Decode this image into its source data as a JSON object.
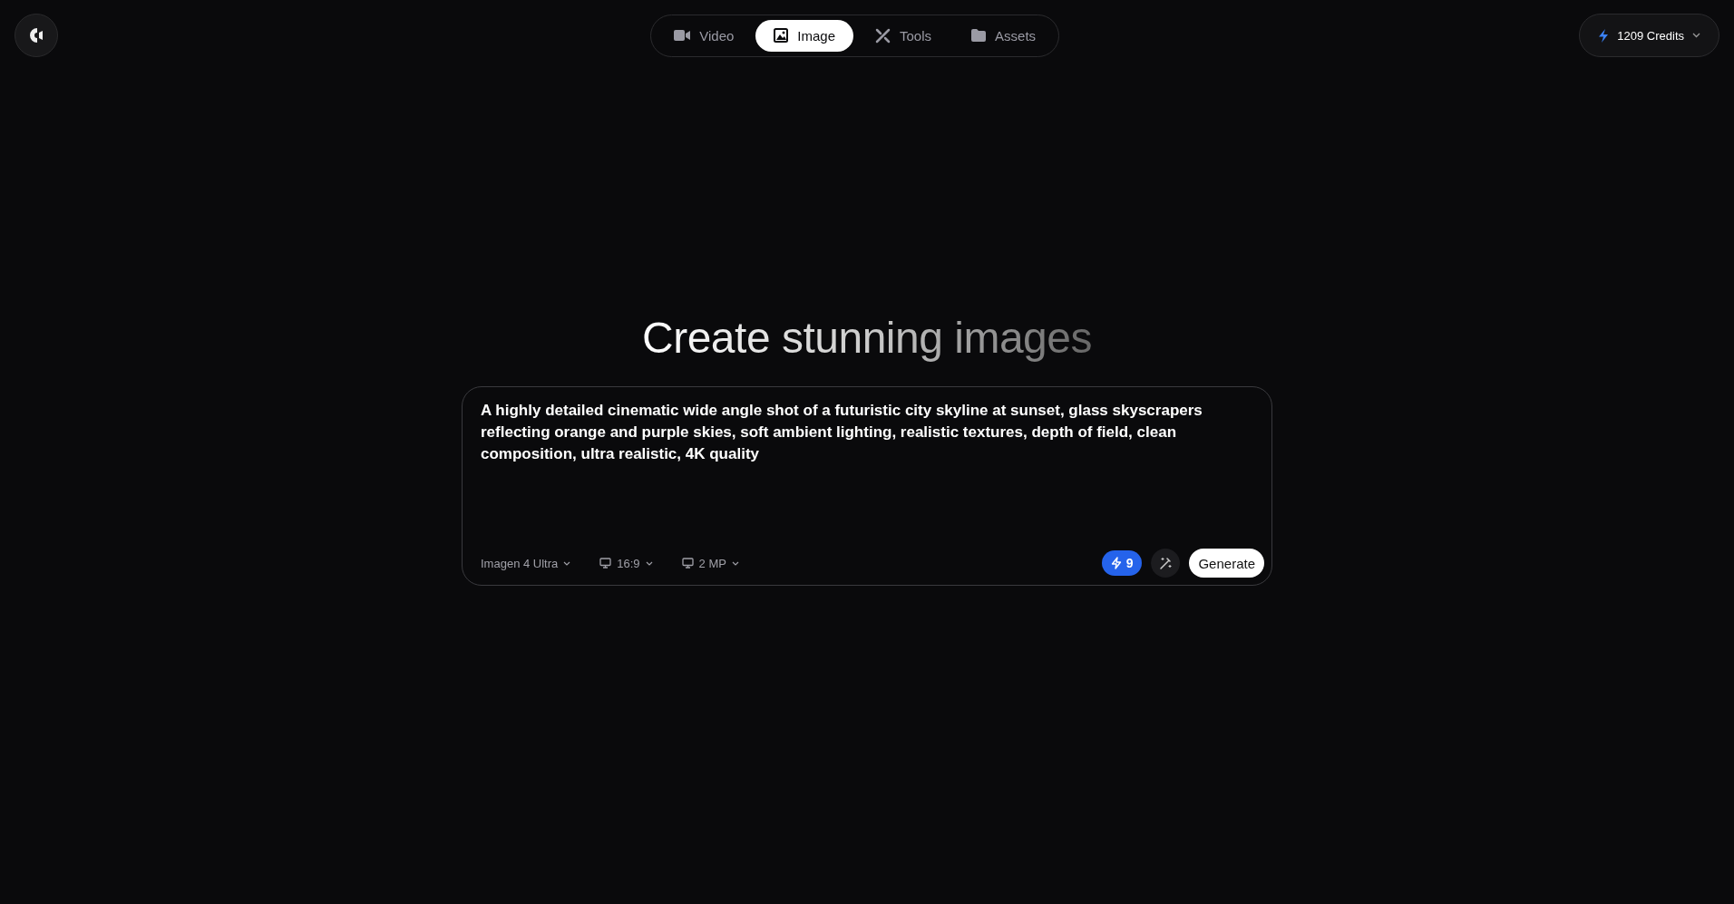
{
  "nav": {
    "tabs": [
      {
        "label": "Video",
        "kind": "video",
        "selected": false
      },
      {
        "label": "Image",
        "kind": "image",
        "selected": true
      },
      {
        "label": "Tools",
        "kind": "tools",
        "selected": false
      },
      {
        "label": "Assets",
        "kind": "folder",
        "selected": false
      }
    ]
  },
  "credits": {
    "label": "1209 Credits"
  },
  "heading": "Create stunning images",
  "prompt": {
    "value": "A highly detailed cinematic wide angle shot of a futuristic city skyline at sunset, glass skyscrapers reflecting orange and purple skies, soft ambient lighting, realistic textures, depth of field, clean composition, ultra realistic, 4K quality"
  },
  "options": [
    {
      "label": "Imagen 4 Ultra",
      "kind": "plain"
    },
    {
      "label": "16:9",
      "kind": "monitor"
    },
    {
      "label": "2 MP",
      "kind": "monitor"
    }
  ],
  "cost": "9",
  "generate": "Generate"
}
